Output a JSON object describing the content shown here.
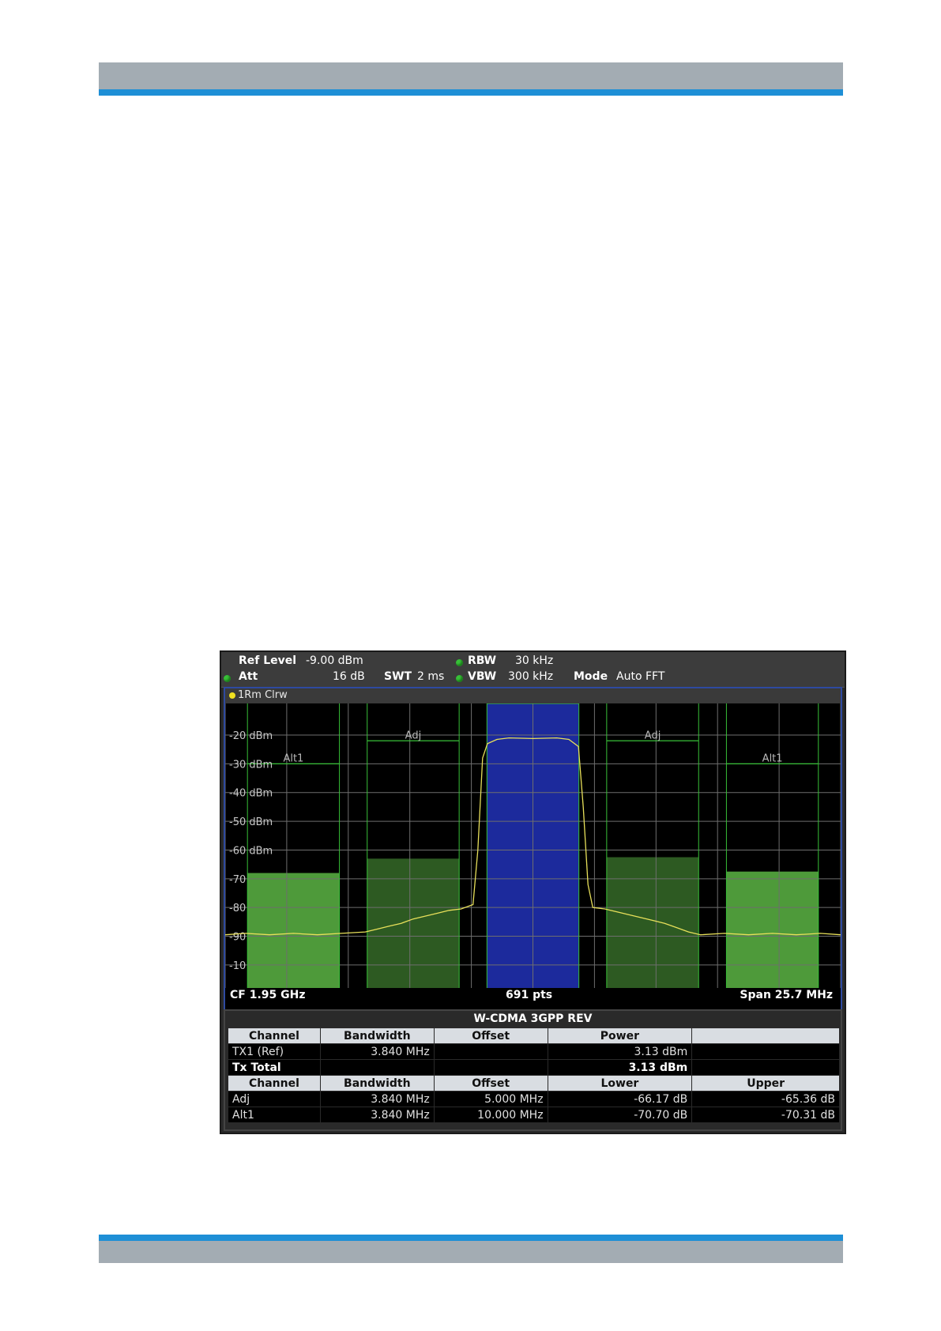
{
  "header": {
    "ref_level_label": "Ref Level",
    "ref_level_value": "-9.00 dBm",
    "att_label": "Att",
    "att_value": "16 dB",
    "swt_label": "SWT",
    "swt_value": "2 ms",
    "rbw_label": "RBW",
    "rbw_value": "30 kHz",
    "vbw_label": "VBW",
    "vbw_value": "300 kHz",
    "mode_label": "Mode",
    "mode_value": "Auto FFT"
  },
  "trace": {
    "label": "1Rm Clrw"
  },
  "footer": {
    "cf": "CF 1.95 GHz",
    "pts": "691 pts",
    "span": "Span 25.7 MHz"
  },
  "colors": {
    "trace": "#e8e05a",
    "tx_channel": "#1c2a9c",
    "adj_channel": "#2d5a22",
    "alt_channel": "#4e9a3a",
    "grid": "#6e6e6e",
    "channel_line": "#38c038"
  },
  "chart_data": {
    "type": "line",
    "title": "",
    "xlabel": "",
    "ylabel": "",
    "y_tick_labels": [
      "-20 dBm",
      "-30 dBm",
      "-40 dBm",
      "-50 dBm",
      "-60 dBm",
      "-70",
      "-80",
      "-90",
      "-10"
    ],
    "ylim": [
      -108,
      -9
    ],
    "xlim_mhz": [
      -12.85,
      12.85
    ],
    "grid": true,
    "channels": [
      {
        "label": "Alt1",
        "offset_mhz": -10.0,
        "bandwidth_mhz": 3.84,
        "level": -68.0,
        "limit": -30.0,
        "color": "#4e9a3a"
      },
      {
        "label": "Adj",
        "offset_mhz": -5.0,
        "bandwidth_mhz": 3.84,
        "level": -63.0,
        "limit": -22.0,
        "color": "#2d5a22"
      },
      {
        "label": "TX1",
        "offset_mhz": 0.0,
        "bandwidth_mhz": 3.84,
        "level": -9.0,
        "limit": -9.0,
        "color": "#1c2a9c"
      },
      {
        "label": "Adj",
        "offset_mhz": 5.0,
        "bandwidth_mhz": 3.84,
        "level": -62.5,
        "limit": -22.0,
        "color": "#2d5a22"
      },
      {
        "label": "Alt1",
        "offset_mhz": 10.0,
        "bandwidth_mhz": 3.84,
        "level": -67.5,
        "limit": -30.0,
        "color": "#4e9a3a"
      }
    ],
    "series": [
      {
        "x": [
          -12.85,
          -12.0,
          -11.0,
          -10.0,
          -9.0,
          -8.0,
          -7.0,
          -6.5,
          -6.0,
          -5.5,
          -5.0,
          -4.5,
          -4.0,
          -3.5,
          -3.0,
          -2.5,
          -2.3,
          -2.1,
          -1.9,
          -1.5,
          -1.0,
          0.0,
          1.0,
          1.5,
          1.9,
          2.1,
          2.3,
          2.5,
          3.0,
          3.5,
          4.0,
          4.5,
          5.0,
          5.5,
          6.0,
          6.5,
          7.0,
          8.0,
          9.0,
          10.0,
          11.0,
          12.0,
          12.85
        ],
        "y": [
          -89.5,
          -89.0,
          -89.5,
          -89.0,
          -89.5,
          -89.0,
          -88.5,
          -87.5,
          -86.5,
          -85.5,
          -84.0,
          -83.0,
          -82.0,
          -81.0,
          -80.5,
          -79.0,
          -60.0,
          -28.0,
          -23.0,
          -21.5,
          -21.0,
          -21.2,
          -21.0,
          -21.5,
          -24.0,
          -45.0,
          -72.0,
          -80.0,
          -80.5,
          -81.5,
          -82.5,
          -83.5,
          -84.5,
          -85.5,
          -87.0,
          -88.5,
          -89.5,
          -89.0,
          -89.5,
          -89.0,
          -89.5,
          -89.0,
          -89.5
        ]
      }
    ]
  },
  "results": {
    "title": "W-CDMA 3GPP REV",
    "tx_header": [
      "Channel",
      "Bandwidth",
      "Offset",
      "Power",
      ""
    ],
    "tx_rows": [
      {
        "channel": "TX1 (Ref)",
        "bandwidth": "3.840 MHz",
        "offset": "",
        "power": "3.13 dBm",
        "extra": ""
      }
    ],
    "total": {
      "label": "Tx Total",
      "power": "3.13 dBm"
    },
    "aclr_header": [
      "Channel",
      "Bandwidth",
      "Offset",
      "Lower",
      "Upper"
    ],
    "aclr_rows": [
      {
        "channel": "Adj",
        "bandwidth": "3.840 MHz",
        "offset": "5.000 MHz",
        "lower": "-66.17 dB",
        "upper": "-65.36 dB"
      },
      {
        "channel": "Alt1",
        "bandwidth": "3.840 MHz",
        "offset": "10.000 MHz",
        "lower": "-70.70 dB",
        "upper": "-70.31 dB"
      }
    ]
  }
}
